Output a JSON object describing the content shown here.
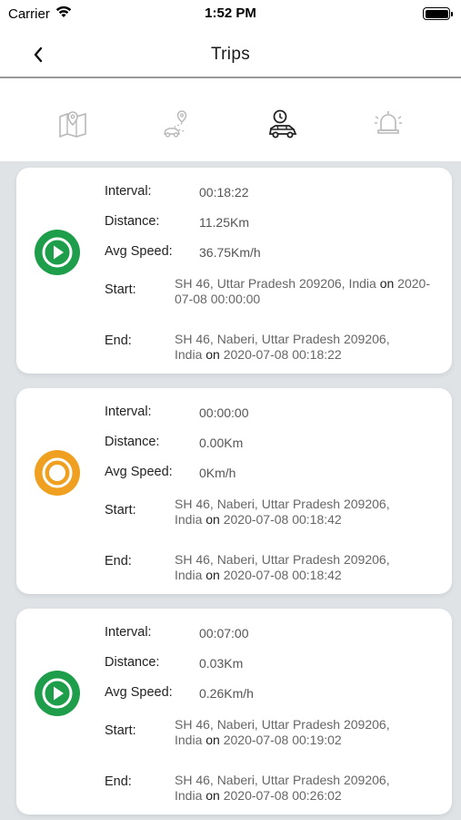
{
  "status_bar": {
    "carrier": "Carrier",
    "time": "1:52 PM"
  },
  "nav": {
    "title": "Trips"
  },
  "tabs": [
    {
      "icon": "map-icon"
    },
    {
      "icon": "route-icon"
    },
    {
      "icon": "car-history-icon"
    },
    {
      "icon": "alarm-bell-icon"
    }
  ],
  "labels": {
    "interval": "Interval:",
    "distance": "Distance:",
    "avg_speed": "Avg Speed:",
    "start": "Start:",
    "end": "End:",
    "on": "on"
  },
  "trips": [
    {
      "status": "play",
      "interval": "00:18:22",
      "distance": "11.25Km",
      "avg_speed": "36.75Km/h",
      "start_addr_1": "SH 46, Uttar Pradesh 209206, India",
      "start_addr_2": "",
      "start_time": "2020-07-08 00:00:00",
      "end_addr_1": "SH 46, Naberi, Uttar Pradesh 209206,",
      "end_addr_2": "India",
      "end_time": "2020-07-08 00:18:22"
    },
    {
      "status": "stopped",
      "interval": "00:00:00",
      "distance": "0.00Km",
      "avg_speed": "0Km/h",
      "start_addr_1": "SH 46, Naberi, Uttar Pradesh 209206,",
      "start_addr_2": "India",
      "start_time": "2020-07-08 00:18:42",
      "end_addr_1": "SH 46, Naberi, Uttar Pradesh 209206,",
      "end_addr_2": "India",
      "end_time": "2020-07-08 00:18:42"
    },
    {
      "status": "play",
      "interval": "00:07:00",
      "distance": "0.03Km",
      "avg_speed": "0.26Km/h",
      "start_addr_1": "SH 46, Naberi, Uttar Pradesh 209206,",
      "start_addr_2": "India",
      "start_time": "2020-07-08 00:19:02",
      "end_addr_1": "SH 46, Naberi, Uttar Pradesh 209206,",
      "end_addr_2": "India",
      "end_time": "2020-07-08 00:26:02"
    }
  ],
  "colors": {
    "play": "#1e9e4a",
    "stopped": "#f0a020",
    "list_bg": "#dfe3e6"
  }
}
